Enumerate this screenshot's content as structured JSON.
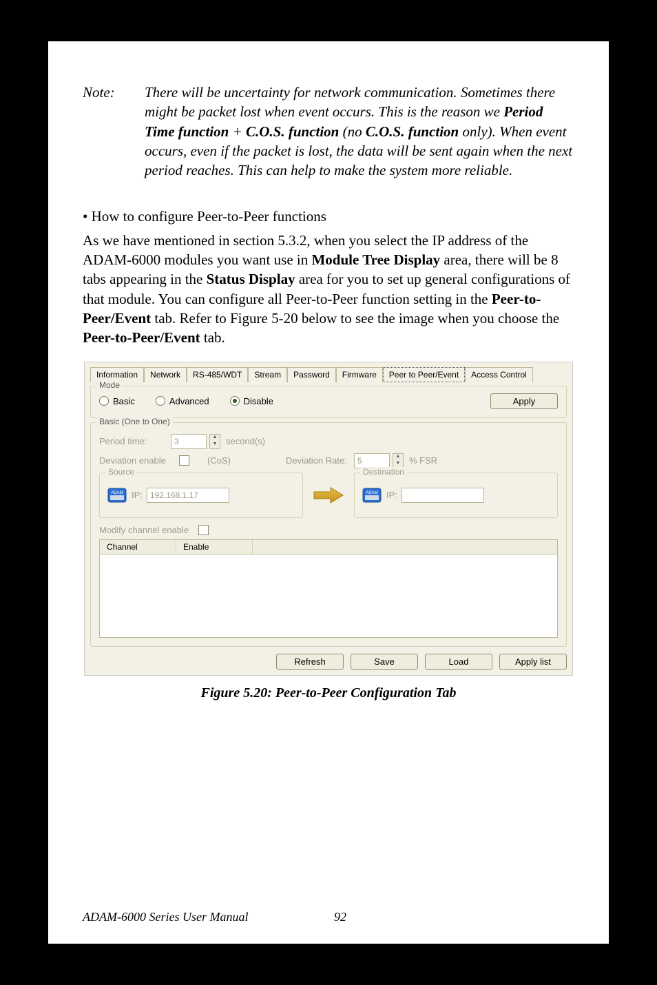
{
  "note": {
    "label": "Note:",
    "text_1": "There will be uncertainty for network communication. Sometimes there might be packet lost when event occurs. This is the reason we ",
    "bold_1": "Period Time function",
    "text_2": " + ",
    "bold_2": "C.O.S. function",
    "text_3": "  (no  ",
    "bold_3": "C.O.S. function",
    "text_4": " only). When event occurs, even if the packet is lost, the data will be sent again when the next period reaches. This can help to make the system more reliable."
  },
  "bullet": "•  How to configure Peer-to-Peer functions",
  "paragraph": {
    "t1": "As we have mentioned in section 5.3.2, when you select the IP address of the ADAM-6000 modules you want use in ",
    "b1": "Module Tree Display",
    "t2": " area, there will be 8 tabs appearing in the ",
    "b2": "Status Display",
    "t3": " area for you to set up general configurations of that module. You can configure all Peer-to-Peer function setting in the ",
    "b3": "Peer-to-Peer/Event",
    "t4": " tab. Refer to Figure 5-20 below to see the image when you choose the ",
    "b4": "Peer-to-Peer/Event",
    "t5": " tab."
  },
  "dialog": {
    "tabs": {
      "info": "Information",
      "network": "Network",
      "rs485": "RS-485/WDT",
      "stream": "Stream",
      "password": "Password",
      "firmware": "Firmware",
      "p2p": "Peer to Peer/Event",
      "access": "Access Control"
    },
    "mode": {
      "legend": "Mode",
      "basic": "Basic",
      "advanced": "Advanced",
      "disable": "Disable",
      "apply": "Apply"
    },
    "basicGroup": {
      "legend": "Basic (One to One)",
      "period_label": "Period time:",
      "period_value": "3",
      "second": "second(s)",
      "dev_enable": "Deviation enable",
      "cos": "(CoS)",
      "dev_rate": "Deviation Rate:",
      "dev_value": "5",
      "fsr": "% FSR",
      "source": "Source",
      "destination": "Destination",
      "ip_label": "IP:",
      "src_ip": "192.168.1.17",
      "dst_ip": "",
      "modchan": "Modify channel enable",
      "col_channel": "Channel",
      "col_enable": "Enable"
    },
    "buttons": {
      "refresh": "Refresh",
      "save": "Save",
      "load": "Load",
      "applylist": "Apply list"
    }
  },
  "caption": "Figure 5.20: Peer-to-Peer Configuration Tab",
  "footer": {
    "title": "ADAM-6000 Series User Manual",
    "page": "92"
  }
}
